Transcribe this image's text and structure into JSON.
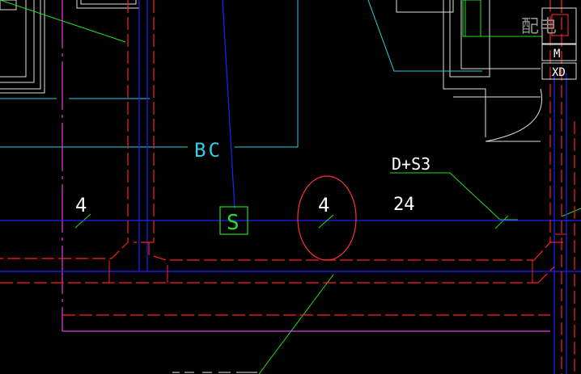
{
  "labels": {
    "bc": "BC",
    "ds3": "D+S3",
    "num_left": "4",
    "num_center": "4",
    "num_right": "24",
    "panel_top_glyph": "配电",
    "panel_m": "M",
    "panel_xd": "XD",
    "switch_symbol": "S"
  },
  "colors": {
    "background": "#000000",
    "blue_cable": "#2020ff",
    "red_dash": "#ff2020",
    "magenta": "#e040e0",
    "cyan": "#30d0e0",
    "green": "#20e020",
    "white": "#e0e0e0",
    "red_ellipse": "#ff3030"
  }
}
